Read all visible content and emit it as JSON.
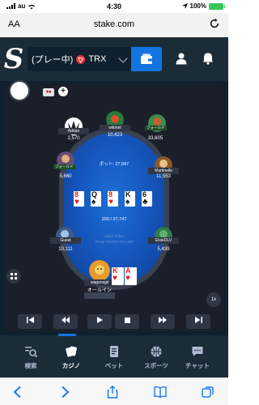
{
  "status_bar": {
    "carrier": "au",
    "time": "4:30",
    "battery": "100%"
  },
  "browser": {
    "text_size_label": "AA",
    "url": "stake.com"
  },
  "header": {
    "game_selector_text": "(プレー中)",
    "currency": "TRX"
  },
  "table": {
    "pot_text": "ポット: 27,947",
    "total_text": "200 / 27,747",
    "felt_line_1": "Stake Poker",
    "felt_line_2": "Texas Hold'em No Limit",
    "board": [
      {
        "rank": "8",
        "suit": "♥",
        "color": "#e31c1c"
      },
      {
        "rank": "Q",
        "suit": "♠",
        "color": "#111111"
      },
      {
        "rank": "8",
        "suit": "♥",
        "color": "#e31c1c"
      },
      {
        "rank": "K",
        "suit": "♠",
        "color": "#111111"
      },
      {
        "rank": "6",
        "suit": "♣",
        "color": "#111111"
      }
    ],
    "hero_cards": [
      {
        "rank": "K",
        "suit": "♥",
        "color": "#e31c1c"
      },
      {
        "rank": "A",
        "suit": "♥",
        "color": "#e31c1c"
      }
    ],
    "hero": {
      "name": "wagonsgii",
      "status": "オールイン"
    },
    "players": [
      {
        "name": "Adrian",
        "chips": "2,570",
        "fold": ""
      },
      {
        "name": "wildnet",
        "chips": "10,423",
        "fold": ""
      },
      {
        "name": "フォールド",
        "chips": "33,605",
        "fold": "フォールド"
      },
      {
        "name": "フォールド",
        "chips": "5,660",
        "fold": "フォールド"
      },
      {
        "name": "Martinelle",
        "chips": "11,553",
        "fold": ""
      },
      {
        "name": "Guest",
        "chips": "10,111",
        "fold": ""
      },
      {
        "name": "ElsieDLV",
        "chips": "5,439",
        "fold": ""
      }
    ]
  },
  "controls": {
    "speed": "1x"
  },
  "nav": [
    {
      "label": "検索",
      "icon": "search-icon"
    },
    {
      "label": "カジノ",
      "icon": "casino-icon"
    },
    {
      "label": "ベット",
      "icon": "bet-icon"
    },
    {
      "label": "スポーツ",
      "icon": "sports-icon"
    },
    {
      "label": "チャット",
      "icon": "chat-icon"
    }
  ],
  "colors": {
    "brand_dark": "#1a2c38",
    "accent_blue": "#1475e1",
    "felt_blue": "#1659c0"
  }
}
